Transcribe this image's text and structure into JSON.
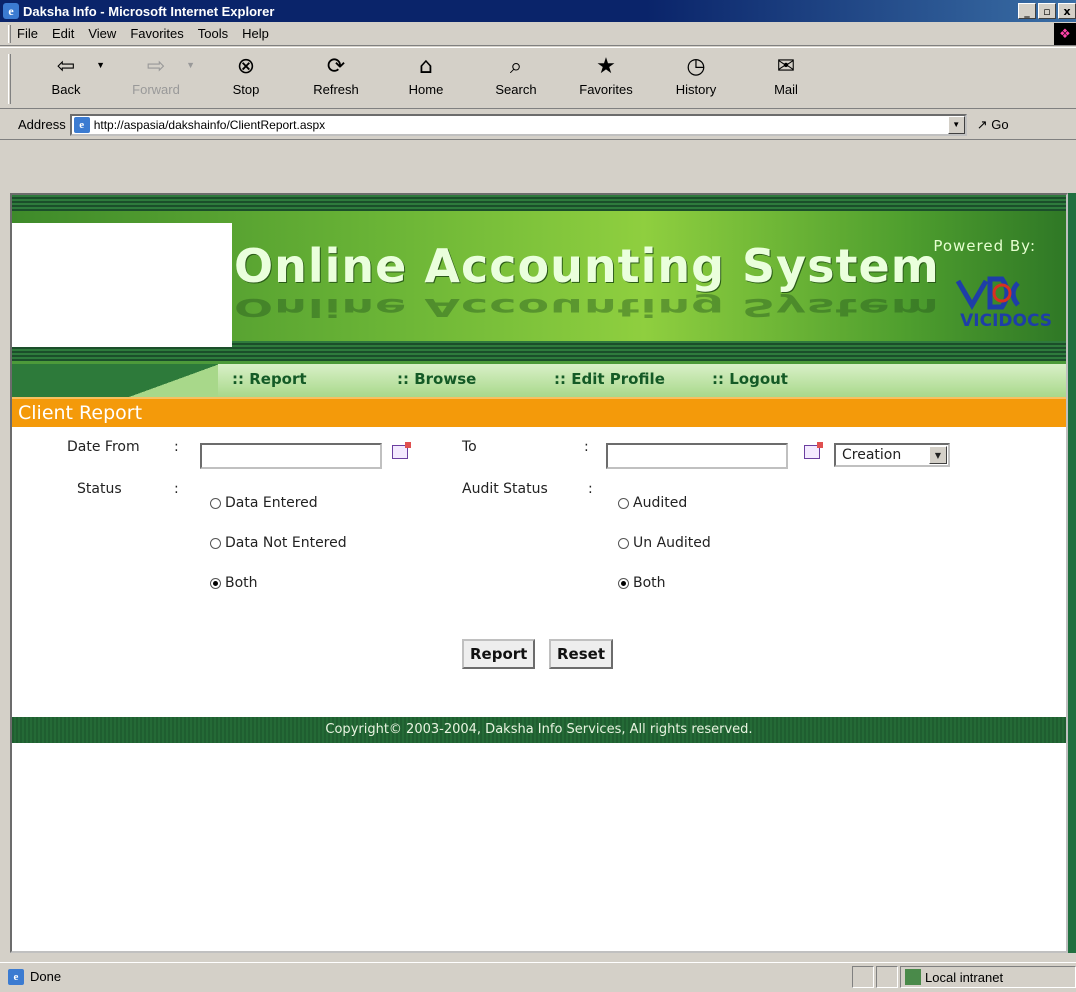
{
  "window": {
    "title": "Daksha Info - Microsoft Internet Explorer",
    "controls": [
      "_",
      "▫",
      "x"
    ]
  },
  "menu": {
    "items": [
      "File",
      "Edit",
      "View",
      "Favorites",
      "Tools",
      "Help"
    ]
  },
  "toolbar": {
    "buttons": [
      {
        "label": "Back",
        "icon": "back-arrow-icon",
        "glyph": "⇦"
      },
      {
        "label": "Forward",
        "icon": "forward-arrow-icon",
        "glyph": "⇨"
      },
      {
        "label": "Stop",
        "icon": "stop-icon",
        "glyph": "⊗"
      },
      {
        "label": "Refresh",
        "icon": "refresh-icon",
        "glyph": "⟳"
      },
      {
        "label": "Home",
        "icon": "home-icon",
        "glyph": "⌂"
      },
      {
        "label": "Search",
        "icon": "search-icon",
        "glyph": "⌕"
      },
      {
        "label": "Favorites",
        "icon": "favorites-icon",
        "glyph": "★"
      },
      {
        "label": "History",
        "icon": "history-icon",
        "glyph": "◷"
      },
      {
        "label": "Mail",
        "icon": "mail-icon",
        "glyph": "✉"
      }
    ]
  },
  "address": {
    "label": "Address",
    "url": "http://aspasia/dakshainfo/ClientReport.aspx",
    "go": "Go"
  },
  "banner": {
    "title": "Online Accounting System",
    "powered_by": "Powered By:",
    "vendor": "VICIDOCS"
  },
  "nav": {
    "items": [
      ":: Report",
      ":: Browse",
      ":: Edit Profile",
      ":: Logout"
    ]
  },
  "page": {
    "heading": "Client Report"
  },
  "form": {
    "date_from_label": "Date From",
    "to_label": "To",
    "colon": ":",
    "date_from_value": "",
    "to_value": "",
    "date_type_selected": "Creation",
    "status_label": "Status",
    "audit_status_label": "Audit Status",
    "status_options": [
      {
        "label": "Data Entered",
        "checked": false
      },
      {
        "label": "Data Not Entered",
        "checked": false
      },
      {
        "label": "Both",
        "checked": true
      }
    ],
    "audit_options": [
      {
        "label": "Audited",
        "checked": false
      },
      {
        "label": "Un Audited",
        "checked": false
      },
      {
        "label": "Both",
        "checked": true
      }
    ],
    "report_button": "Report",
    "reset_button": "Reset"
  },
  "footer": {
    "copyright": "Copyright© 2003-2004, Daksha Info Services, All rights reserved."
  },
  "status": {
    "text": "Done",
    "zone": "Local intranet"
  },
  "colors": {
    "header_orange": "#f49a0a",
    "footer_green": "#1f5e30",
    "nav_green": "#145a26"
  }
}
